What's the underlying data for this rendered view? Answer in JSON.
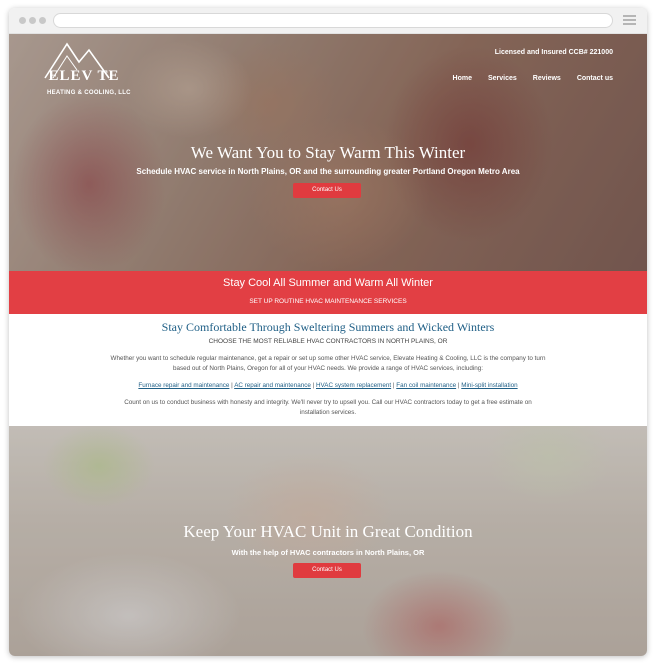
{
  "site": {
    "logo_word": "ELEV TE",
    "logo_sub": "HEATING & COOLING, LLC",
    "license": "Licensed and Insured CCB# 221000"
  },
  "nav": {
    "items": [
      {
        "label": "Home"
      },
      {
        "label": "Services"
      },
      {
        "label": "Reviews"
      },
      {
        "label": "Contact us"
      }
    ]
  },
  "hero": {
    "title": "We Want You to Stay Warm This Winter",
    "subtitle": "Schedule HVAC service in North Plains, OR and the surrounding greater Portland Oregon Metro Area",
    "button": "Contact Us"
  },
  "band": {
    "title": "Stay Cool All Summer and Warm All Winter",
    "subtitle": "SET UP ROUTINE HVAC MAINTENANCE SERVICES"
  },
  "content": {
    "title": "Stay Comfortable Through Sweltering Summers and Wicked Winters",
    "subtitle": "CHOOSE THE MOST RELIABLE HVAC CONTRACTORS IN NORTH PLAINS, OR",
    "paragraph": "Whether you want to schedule regular maintenance, get a repair or set up some other HVAC service, Elevate Heating & Cooling, LLC is the company to turn based out of North Plains, Oregon for all of your HVAC needs. We provide a range of HVAC services, including:",
    "links": [
      {
        "label": "Furnace repair and maintenance"
      },
      {
        "label": "AC repair and maintenance"
      },
      {
        "label": "HVAC system replacement"
      },
      {
        "label": "Fan coil maintenance"
      },
      {
        "label": "Mini-split installation"
      }
    ],
    "separator": "|",
    "paragraph2": "Count on us to conduct business with honesty and integrity. We'll never try to upsell you. Call our HVAC contractors today to get a free estimate on installation services."
  },
  "hero2": {
    "title": "Keep Your HVAC Unit in Great Condition",
    "subtitle": "With the help of HVAC contractors in North Plains, OR",
    "button": "Contact Us"
  },
  "colors": {
    "accent_red": "#e23f44",
    "heading_blue": "#1f5f86"
  }
}
